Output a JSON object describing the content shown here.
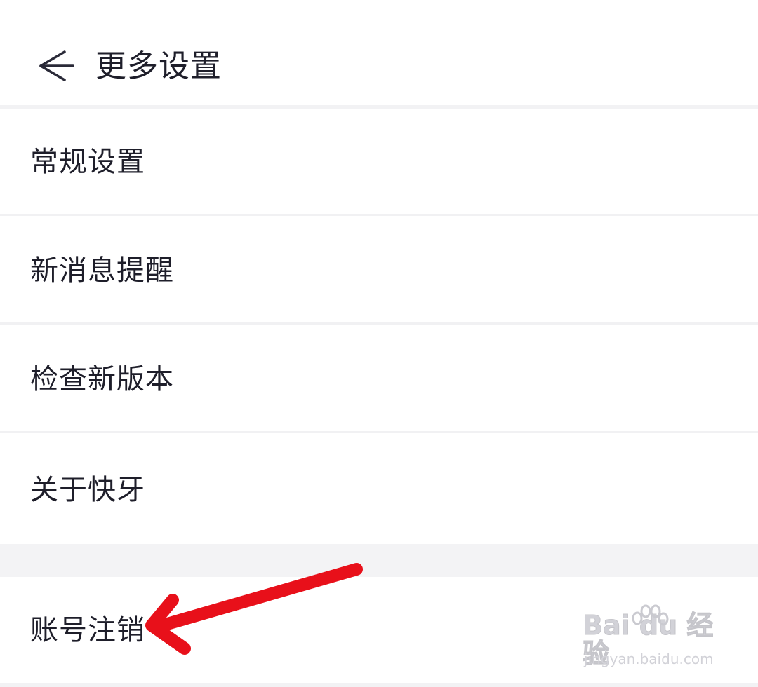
{
  "header": {
    "title": "更多设置"
  },
  "menu": {
    "group1": [
      {
        "label": "常规设置"
      },
      {
        "label": "新消息提醒"
      },
      {
        "label": "检查新版本"
      },
      {
        "label": "关于快牙"
      }
    ],
    "group2": [
      {
        "label": "账号注销"
      }
    ]
  },
  "annotation": {
    "arrow_color": "#e8101a"
  },
  "watermark": {
    "brand": "Bai du 经验",
    "url": "jingyan.baidu.com"
  },
  "icons": {
    "back": "arrow-left-icon",
    "watermark_logo": "baidu-paw-icon"
  }
}
